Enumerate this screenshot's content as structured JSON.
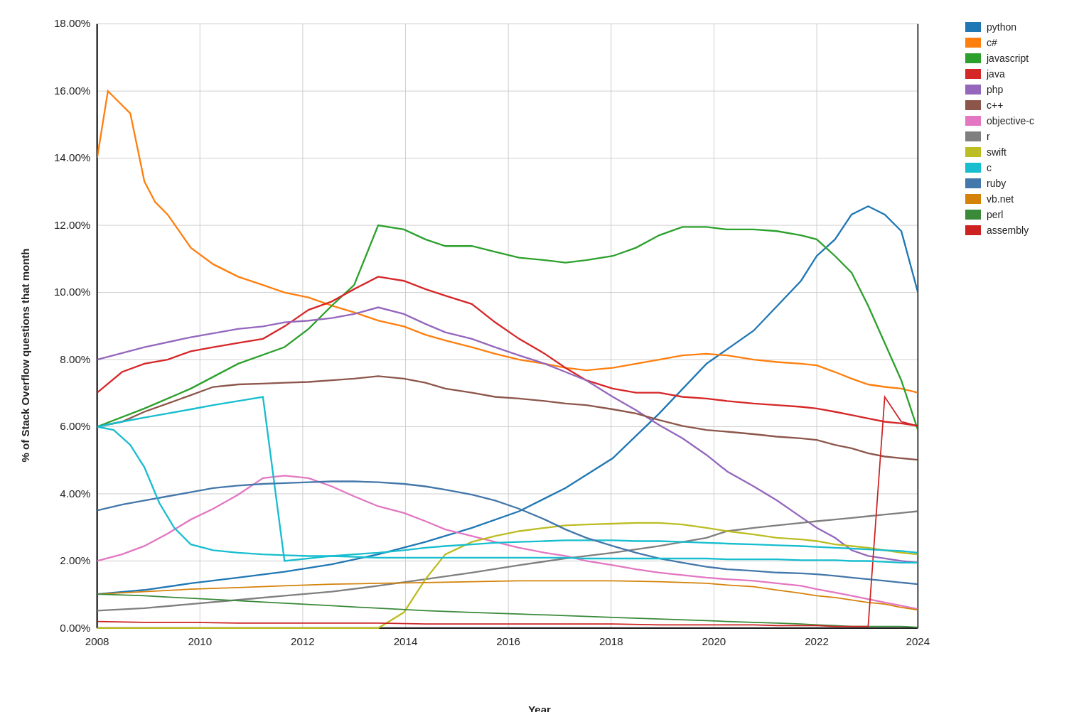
{
  "chart": {
    "title": "",
    "y_axis_label": "% of Stack Overflow questions that month",
    "x_axis_label": "Year",
    "y_ticks": [
      "0.00%",
      "2.00%",
      "4.00%",
      "6.00%",
      "8.00%",
      "10.00%",
      "12.00%",
      "14.00%",
      "16.00%",
      "18.00%"
    ],
    "x_ticks": [
      "2008",
      "2010",
      "2012",
      "2014",
      "2016",
      "2018",
      "2020",
      "2022",
      "2024"
    ],
    "legend": [
      {
        "label": "python",
        "color": "#1f77b4"
      },
      {
        "label": "c#",
        "color": "#ff7f0e"
      },
      {
        "label": "javascript",
        "color": "#2ca02c"
      },
      {
        "label": "java",
        "color": "#d62728"
      },
      {
        "label": "php",
        "color": "#9467bd"
      },
      {
        "label": "c++",
        "color": "#8c564b"
      },
      {
        "label": "objective-c",
        "color": "#e377c2"
      },
      {
        "label": "r",
        "color": "#7f7f7f"
      },
      {
        "label": "swift",
        "color": "#bcbd22"
      },
      {
        "label": "c",
        "color": "#17becf"
      },
      {
        "label": "ruby",
        "color": "#4477aa"
      },
      {
        "label": "vb.net",
        "color": "#ff7f0e"
      },
      {
        "label": "perl",
        "color": "#3a8a3a"
      },
      {
        "label": "assembly",
        "color": "#cc2222"
      }
    ]
  }
}
